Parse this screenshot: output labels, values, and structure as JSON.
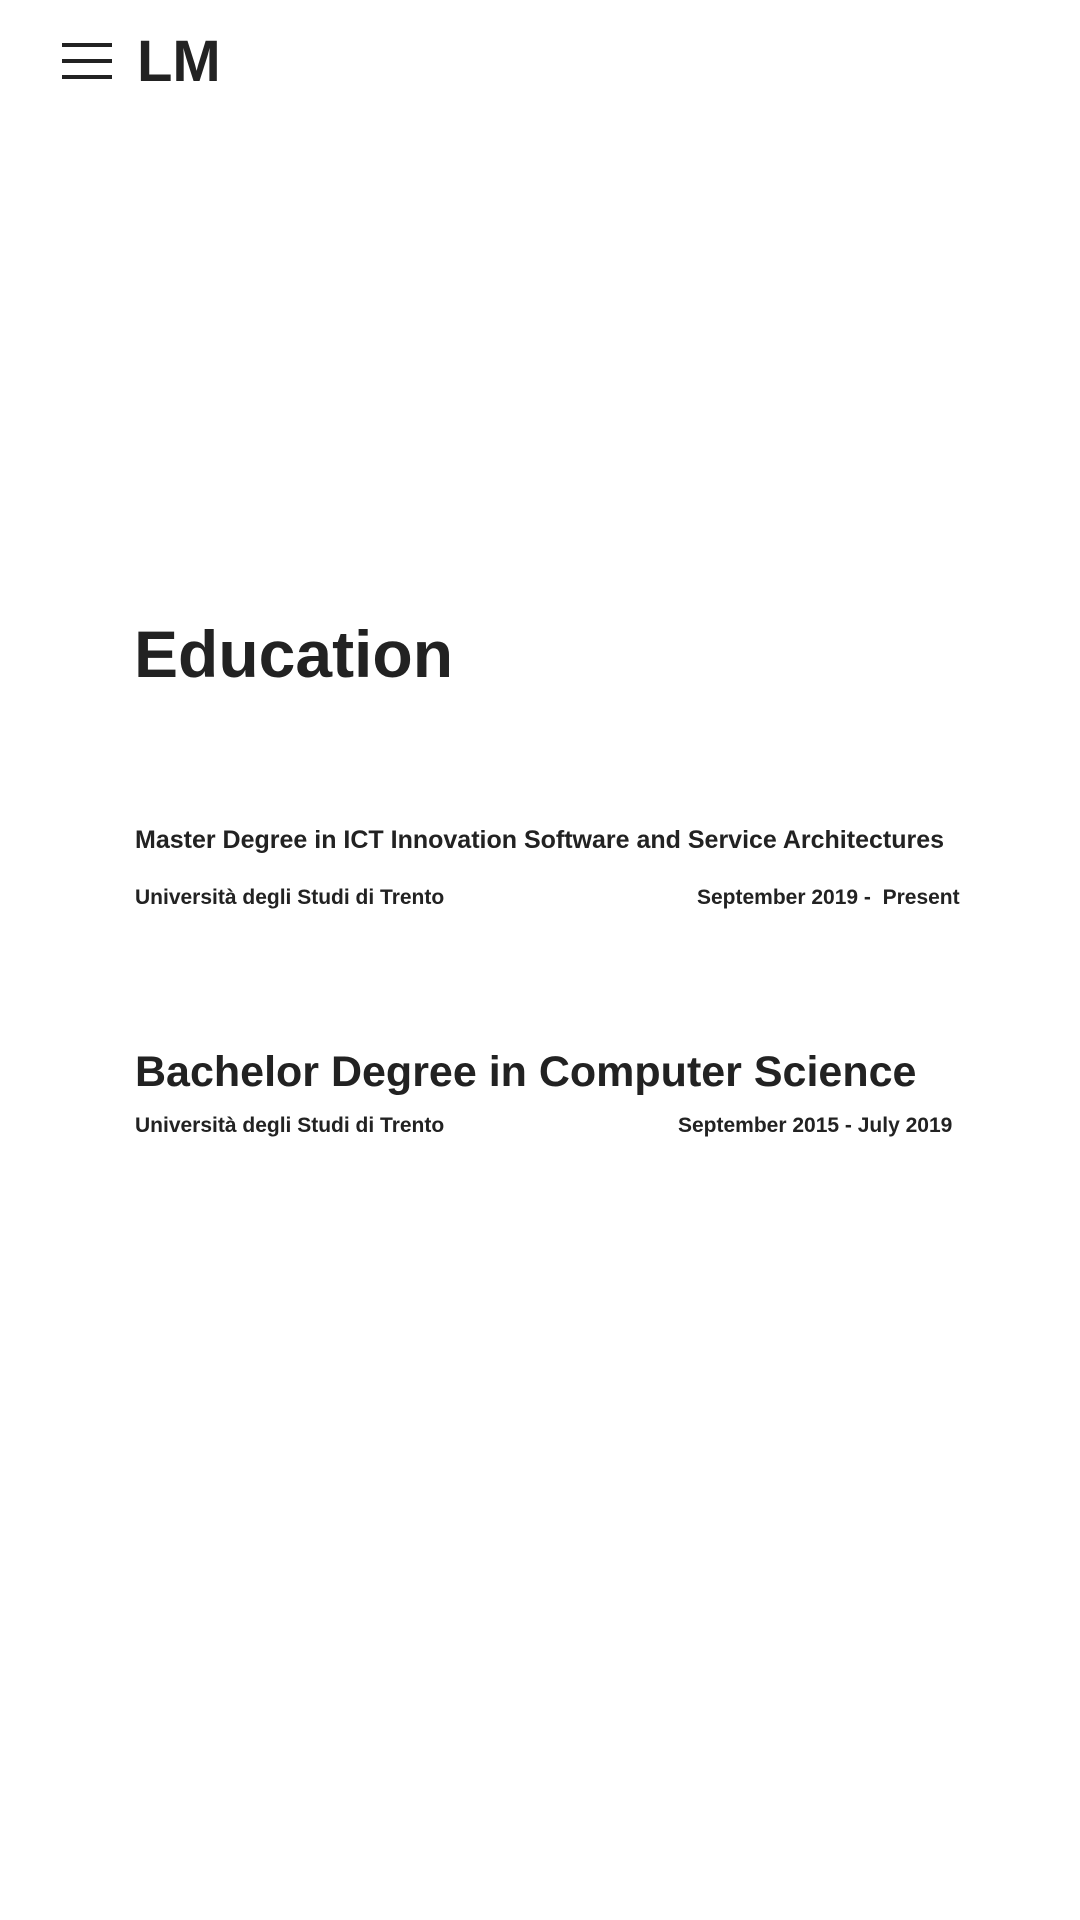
{
  "header": {
    "logo": "LM",
    "menu_icon": "hamburger-menu-icon"
  },
  "education": {
    "title": "Education",
    "entries": [
      {
        "degree": "Master Degree in ICT Innovation Software and Service Architectures",
        "institution": "Università degli Studi di Trento",
        "dates": "September 2019 -  Present"
      },
      {
        "degree": "Bachelor Degree in Computer Science",
        "institution": "Università degli Studi di Trento",
        "dates": "September 2015 - July 2019"
      }
    ]
  },
  "colors": {
    "text": "#222222",
    "background": "#ffffff"
  }
}
